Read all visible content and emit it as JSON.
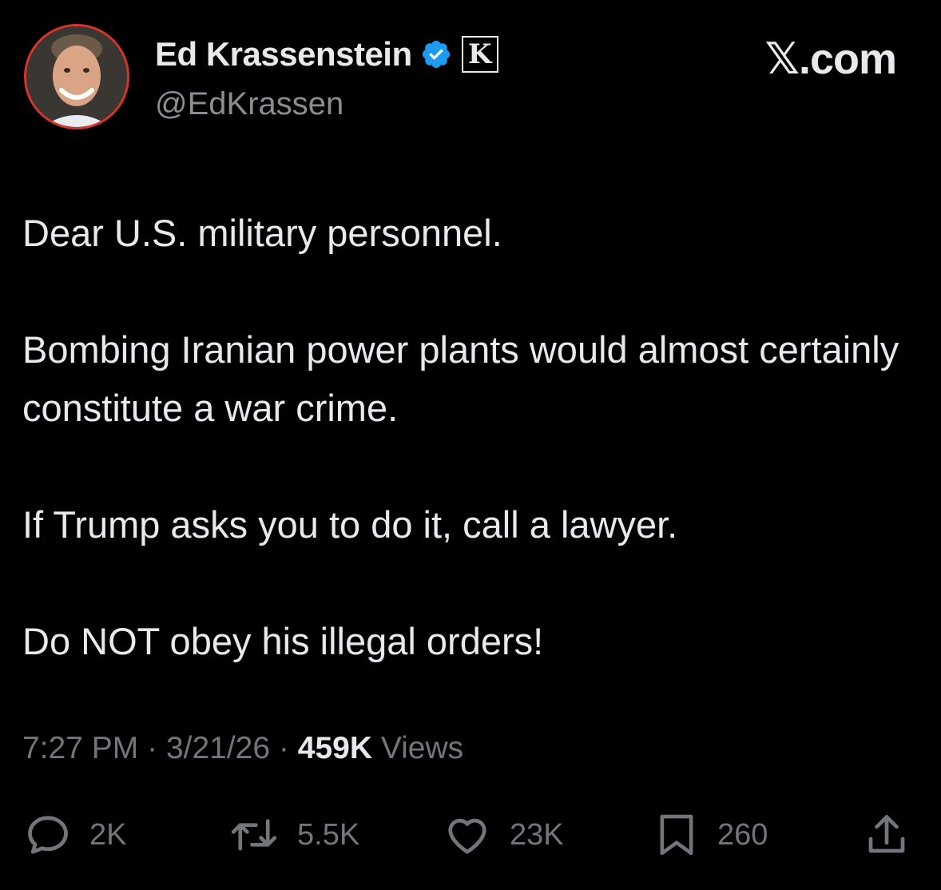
{
  "author": {
    "display_name": "Ed Krassenstein",
    "handle": "@EdKrassen",
    "verified_badge_icon": "verified-check-icon",
    "affiliation_badge": "K",
    "avatar_icon": "profile-photo"
  },
  "brand": {
    "label": "𝕏.com"
  },
  "tweet": {
    "paragraphs": [
      "Dear U.S. military personnel.",
      "Bombing Iranian power plants would almost certainly constitute a war crime.",
      "If Trump asks you to do it, call a lawyer.",
      "Do NOT obey his illegal orders!"
    ]
  },
  "meta": {
    "time": "7:27 PM",
    "date": "3/21/26",
    "separator": "·",
    "views_count": "459K",
    "views_label": "Views"
  },
  "actions": {
    "replies": {
      "icon": "reply-icon",
      "count": "2K"
    },
    "reposts": {
      "icon": "repost-icon",
      "count": "5.5K"
    },
    "likes": {
      "icon": "heart-icon",
      "count": "23K"
    },
    "bookmarks": {
      "icon": "bookmark-icon",
      "count": "260"
    },
    "share": {
      "icon": "share-icon"
    }
  },
  "colors": {
    "background": "#000000",
    "text": "#e7e9ea",
    "muted": "#71767b",
    "verified": "#1d9bf0",
    "avatar_ring": "#d9342b"
  }
}
